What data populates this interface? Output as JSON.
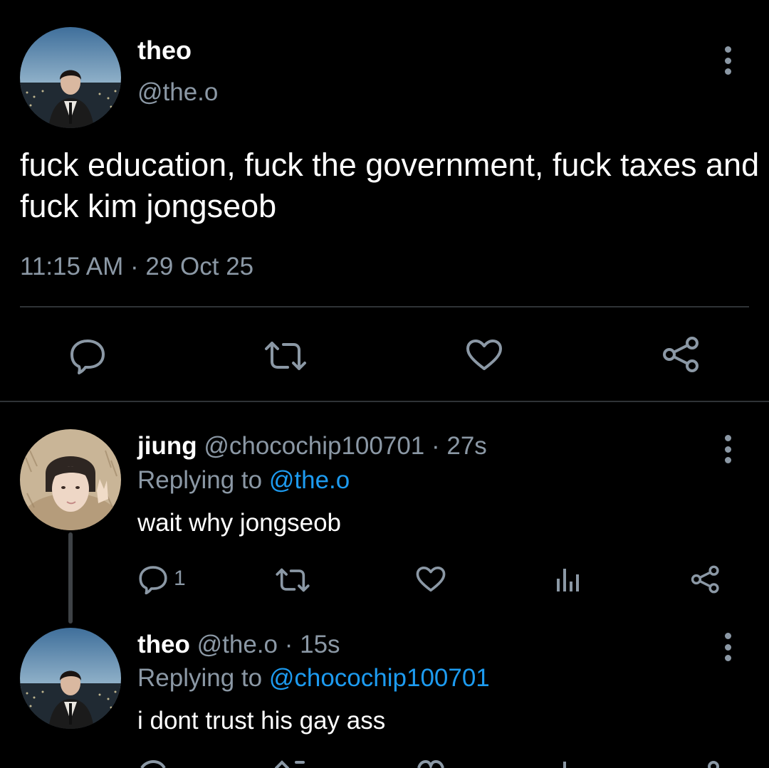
{
  "colors": {
    "background": "#000000",
    "text": "#ffffff",
    "muted": "#8b98a5",
    "link": "#1d9bf0",
    "divider": "#2f3336"
  },
  "main_tweet": {
    "author_name": "theo",
    "author_handle": "@the.o",
    "text": "fuck education, fuck the government, fuck taxes and fuck kim jongseob",
    "timestamp": "11:15 AM · 29 Oct 25",
    "actions": [
      "reply-icon",
      "retweet-icon",
      "like-icon",
      "share-icon"
    ]
  },
  "replies": [
    {
      "author_name": "jiung",
      "author_handle": "@chocochip100701",
      "age": "· 27s",
      "replying_label": "Replying to",
      "replying_to": "@the.o",
      "text": "wait why jongseob",
      "reply_count": "1",
      "actions": [
        "reply-icon",
        "retweet-icon",
        "like-icon",
        "analytics-icon",
        "share-icon"
      ]
    },
    {
      "author_name": "theo",
      "author_handle": "@the.o",
      "age": "· 15s",
      "replying_label": "Replying to",
      "replying_to": "@chocochip100701",
      "text": "i dont trust his gay ass"
    }
  ]
}
